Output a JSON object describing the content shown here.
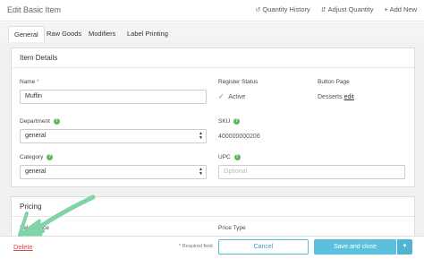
{
  "header": {
    "title": "Edit Basic Item",
    "actions": [
      {
        "label": "Quantity History",
        "icon": "history-icon"
      },
      {
        "label": "Adjust Quantity",
        "icon": "adjust-icon"
      },
      {
        "label": "+ Add New",
        "icon": ""
      }
    ]
  },
  "tabs": [
    {
      "label": "General",
      "active": true
    },
    {
      "label": "Raw Goods",
      "active": false
    },
    {
      "label": "Modifiers",
      "active": false
    },
    {
      "label": "Label Printing",
      "active": false
    }
  ],
  "item_details": {
    "title": "Item Details",
    "name": {
      "label": "Name",
      "required_mark": "*",
      "value": "Muffin"
    },
    "register_status": {
      "label": "Register Status",
      "value": "Active"
    },
    "button_page": {
      "label": "Button Page",
      "value": "Desserts",
      "edit_label": "edit"
    },
    "department": {
      "label": "Department",
      "value": "general"
    },
    "sku": {
      "label": "SKU",
      "value": "400000000206"
    },
    "category": {
      "label": "Category",
      "value": "general"
    },
    "upc": {
      "label": "UPC",
      "placeholder": "Optional"
    }
  },
  "pricing": {
    "title": "Pricing",
    "sales_price_label": "Sales Price",
    "price_type_label": "Price Type"
  },
  "footer": {
    "delete_label": "Delete",
    "required_note": "* Required field",
    "cancel_label": "Cancel",
    "save_label": "Save and close"
  },
  "colors": {
    "accent": "#5bc0de",
    "delete": "#e04848",
    "annotation_arrow": "#7fd4a8",
    "help_badge": "#5cb85c"
  }
}
